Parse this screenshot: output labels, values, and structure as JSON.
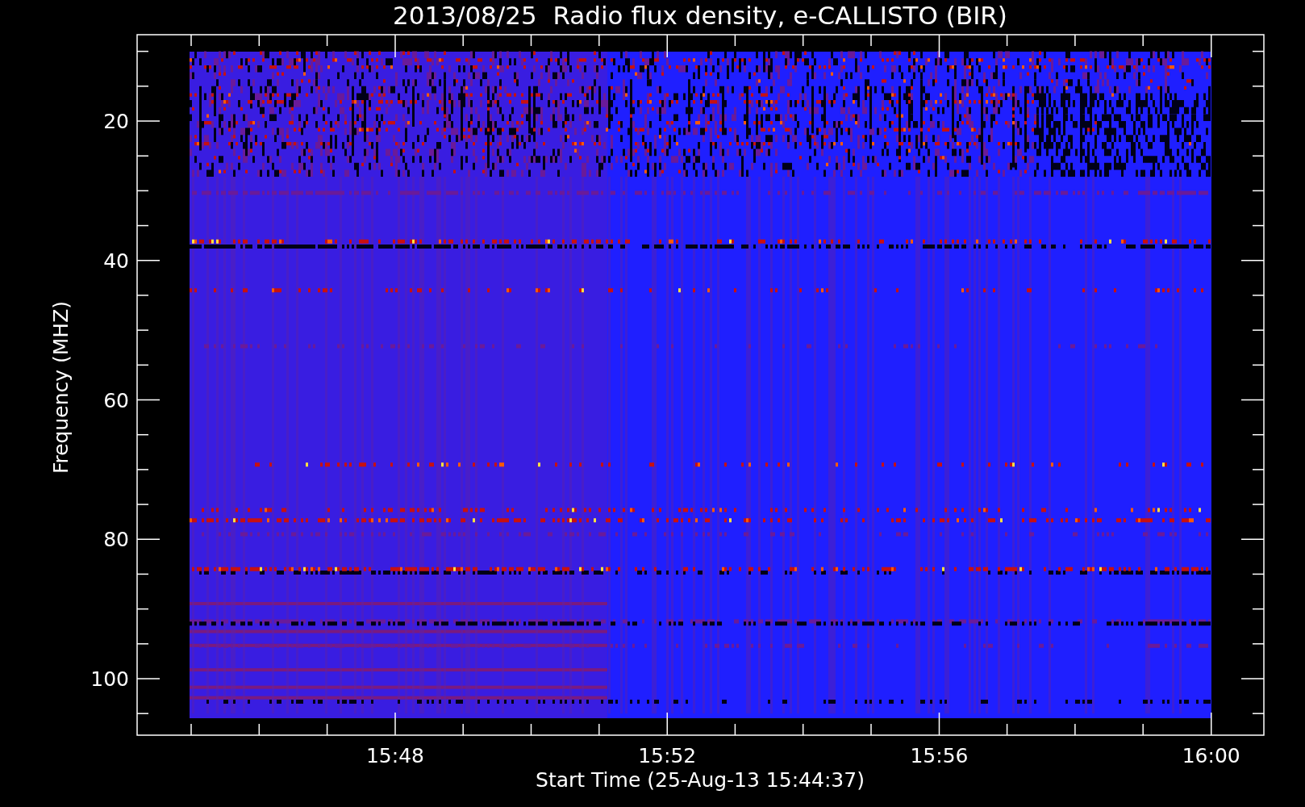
{
  "title": "2013/08/25  Radio flux density, e-CALLISTO (BIR)",
  "y_axis": {
    "label": "Frequency (MHZ)",
    "ticks": [
      "20",
      "40",
      "60",
      "80",
      "100"
    ]
  },
  "x_axis": {
    "label": "Start Time (25-Aug-13 15:44:37)",
    "ticks": [
      "15:48",
      "15:52",
      "15:56",
      "16:00"
    ]
  }
}
